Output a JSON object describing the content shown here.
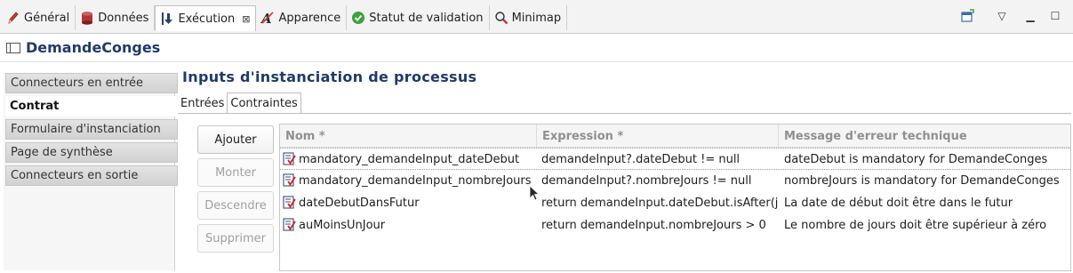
{
  "top_tabs": [
    {
      "label": "Général",
      "icon": "pencil-icon"
    },
    {
      "label": "Données",
      "icon": "database-icon"
    },
    {
      "label": "Exécution",
      "icon": "download-arrow-icon",
      "active": true
    },
    {
      "label": "Apparence",
      "icon": "font-a-icon"
    },
    {
      "label": "Statut de validation",
      "icon": "check-circle-icon"
    },
    {
      "label": "Minimap",
      "icon": "magnifier-icon"
    }
  ],
  "close_glyph": "⊠",
  "window_controls": {
    "menu_glyph": "▽",
    "minimize_glyph": "▁",
    "maximize_glyph": "☐"
  },
  "title": "DemandeConges",
  "nav": [
    {
      "label": "Connecteurs en entrée"
    },
    {
      "label": "Contrat",
      "selected": true
    },
    {
      "label": "Formulaire d'instanciation"
    },
    {
      "label": "Page de synthèse"
    },
    {
      "label": "Connecteurs en sortie"
    }
  ],
  "heading": "Inputs d'instanciation de processus",
  "sub_tabs": [
    {
      "label": "Entrées"
    },
    {
      "label": "Contraintes",
      "active": true
    }
  ],
  "buttons": {
    "add": "Ajouter",
    "up": "Monter",
    "down": "Descendre",
    "delete": "Supprimer"
  },
  "columns": [
    "Nom *",
    "Expression *",
    "Message d'erreur technique"
  ],
  "rows": [
    {
      "name": "mandatory_demandeInput_dateDebut",
      "expression": "demandeInput?.dateDebut != null",
      "message": "dateDebut is mandatory for DemandeConges"
    },
    {
      "name": "mandatory_demandeInput_nombreJours",
      "expression": "demandeInput?.nombreJours != null",
      "message": "nombreJours is mandatory for DemandeConges"
    },
    {
      "name": "dateDebutDansFutur",
      "expression": "return demandeInput.dateDebut.isAfter(ja",
      "message": "La date de début doit être dans le futur"
    },
    {
      "name": "auMoinsUnJour",
      "expression": "return demandeInput.nombreJours > 0",
      "message": "Le nombre de jours doit être supérieur à zéro"
    }
  ],
  "colors": {
    "heading": "#1f3b6b",
    "header_text": "#909090"
  }
}
